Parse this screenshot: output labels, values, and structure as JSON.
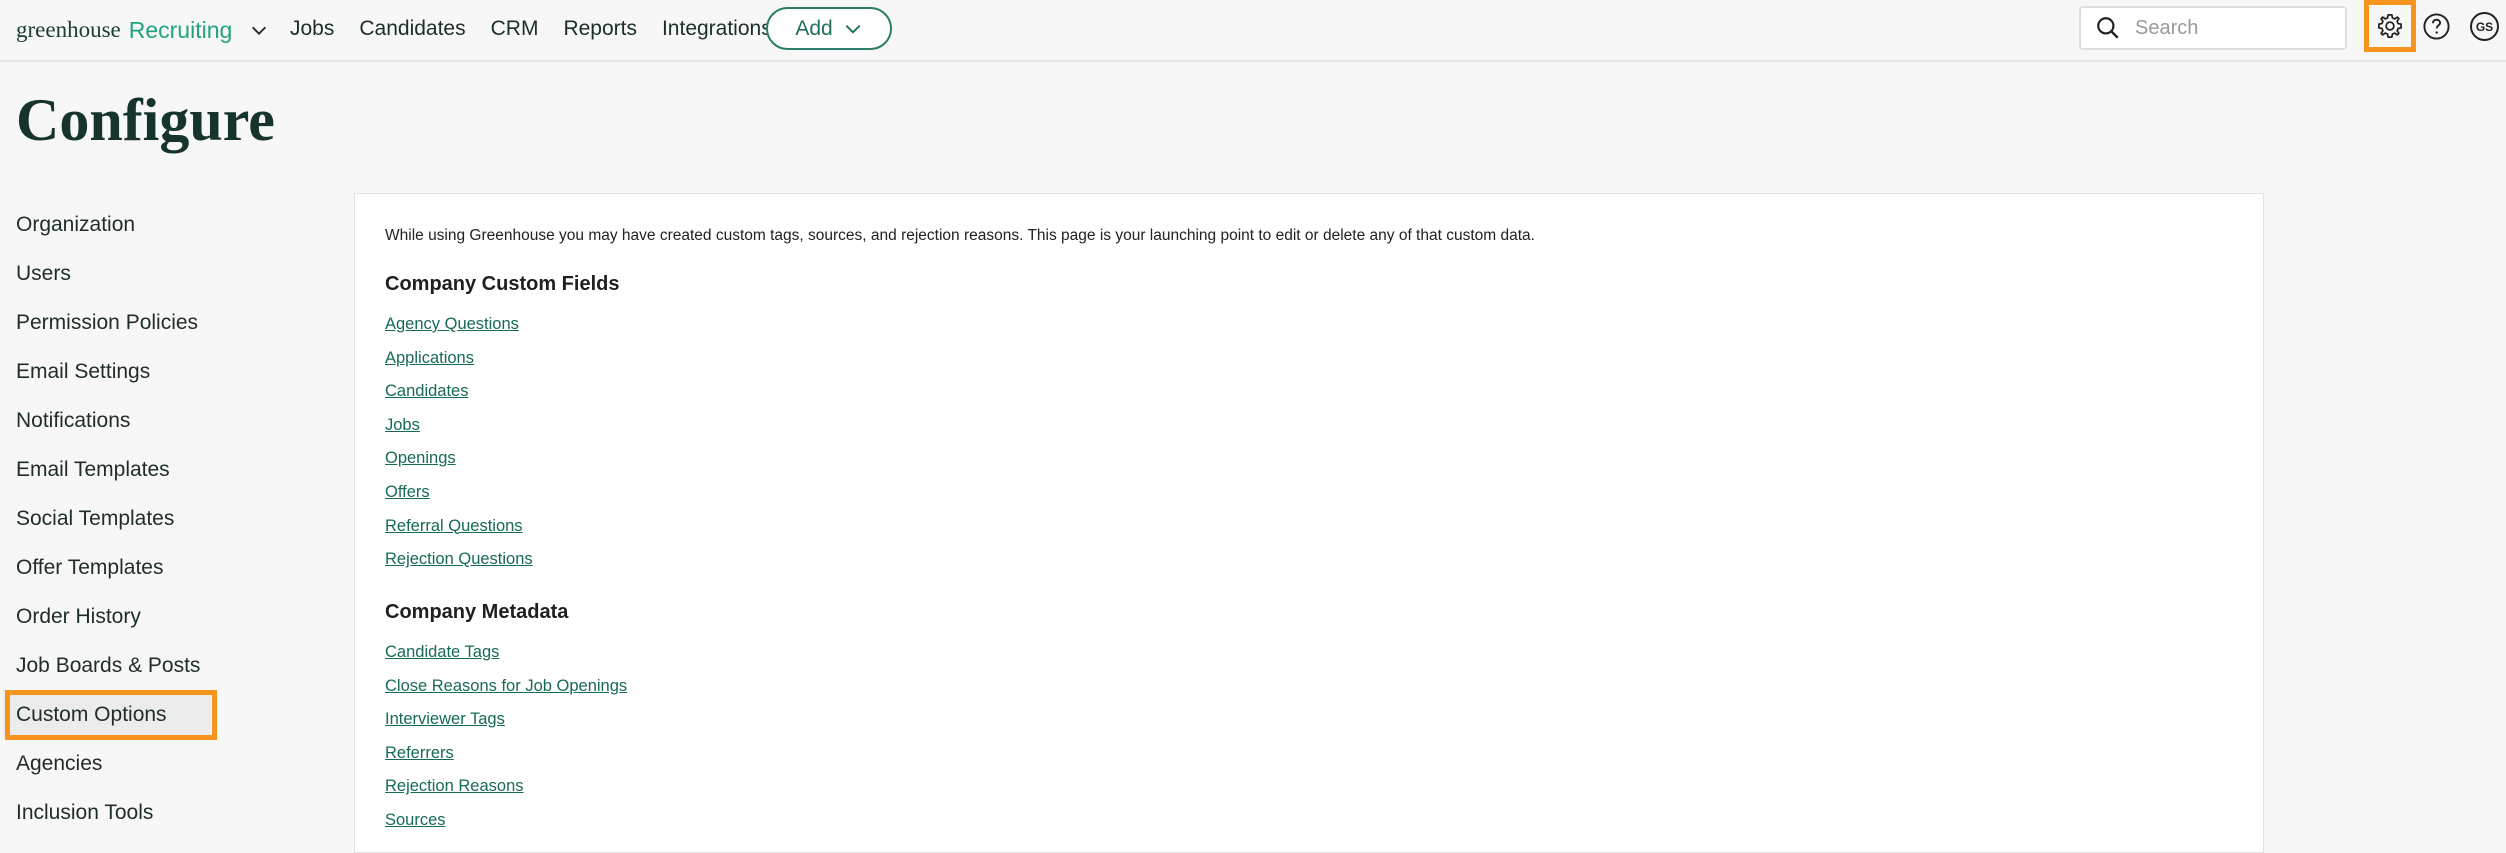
{
  "header": {
    "logo_word": "greenhouse",
    "logo_product": "Recruiting",
    "nav": [
      "Jobs",
      "Candidates",
      "CRM",
      "Reports",
      "Integrations"
    ],
    "add_label": "Add",
    "search_placeholder": "Search",
    "avatar_initials": "GS"
  },
  "page": {
    "title": "Configure"
  },
  "sidebar": {
    "items": [
      "Organization",
      "Users",
      "Permission Policies",
      "Email Settings",
      "Notifications",
      "Email Templates",
      "Social Templates",
      "Offer Templates",
      "Order History",
      "Job Boards & Posts",
      "Custom Options",
      "Agencies",
      "Inclusion Tools"
    ],
    "active": "Custom Options"
  },
  "main": {
    "intro": "While using Greenhouse you may have created custom tags, sources, and rejection reasons. This page is your launching point to edit or delete any of that custom data.",
    "custom_fields_heading": "Company Custom Fields",
    "custom_fields": [
      "Agency Questions",
      "Applications",
      "Candidates",
      "Jobs",
      "Openings",
      "Offers",
      "Referral Questions",
      "Rejection Questions"
    ],
    "metadata_heading": "Company Metadata",
    "metadata": [
      "Candidate Tags",
      "Close Reasons for Job Openings",
      "Interviewer Tags",
      "Referrers",
      "Rejection Reasons",
      "Sources"
    ]
  },
  "colors": {
    "accent": "#23a47f",
    "highlight": "#f7941d",
    "link": "#176a56"
  }
}
